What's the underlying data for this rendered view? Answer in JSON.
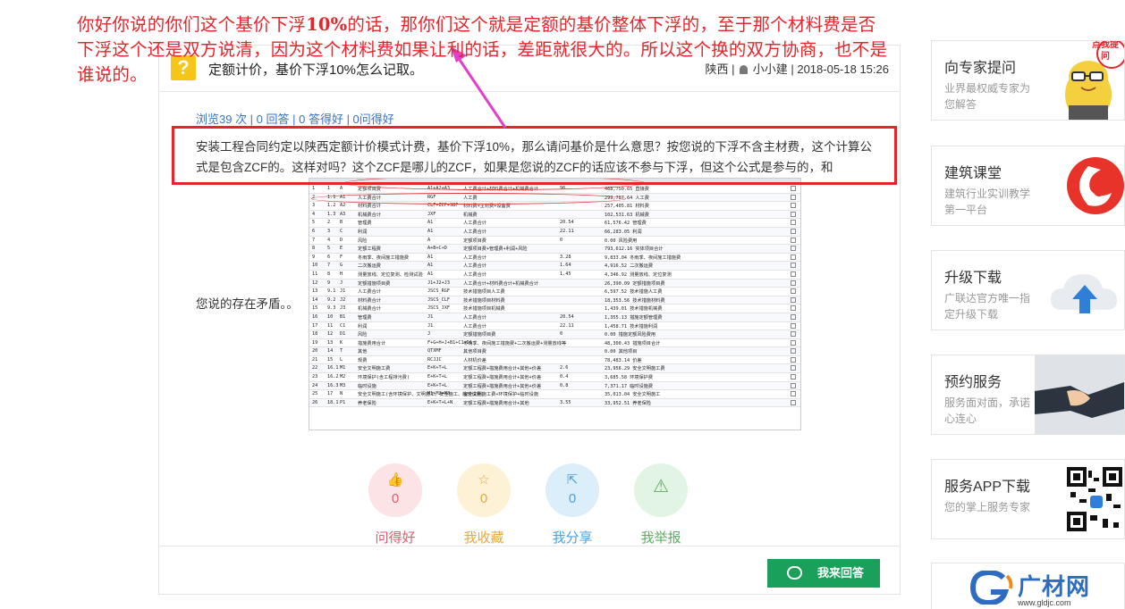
{
  "annotation": {
    "line1": "你好你说的你们这个基价下浮",
    "line1_bold": "10%",
    "line1_rest": "的话，那你们这个就是定额的基价整体下浮的，至于那个材料费是否",
    "line2": "下浮这个还是双方说清，因为这个材料费如果让利的话，差距就很大的。所以这个换的双方协商，也不是",
    "line3": "谁说的。"
  },
  "question": {
    "icon": "?",
    "title": "定额计价，基价下浮10%怎么记取。",
    "region": "陕西",
    "author": "小小建",
    "date": "2018-05-18 15:26",
    "stats": "浏览39 次 | 0 回答 | 0 答得好 | 0问得好",
    "body": "安装工程合同约定以陕西定额计价模式计费，基价下浮10%，那么请问基价是什么意思？按您说的下浮不含主材费，这个计算公式是包含ZCF的。这样对吗？这个ZCF是哪儿的ZCF，如果是您说的ZCF的话应该不参与下浮，但这个公式是参与的，和",
    "note": "您说的存在矛盾。。"
  },
  "sheet": {
    "rows": [
      [
        "1",
        "1",
        "A",
        "定额项目费",
        "A1+A2+A3",
        "人工费合计+材料费合计+机械费合计",
        "96",
        "468,750.65 直接费"
      ],
      [
        "2",
        "1.1",
        "A1",
        "人工费合计",
        "RGF",
        "人工费",
        "",
        "299,787.64 人工费"
      ],
      [
        "3",
        "1.2",
        "A2",
        "材料费合计",
        "CLF+ZCF+SBF",
        "材料费+主材费+设备费",
        "",
        "257,405.81 材料费"
      ],
      [
        "4",
        "1.3",
        "A3",
        "机械费合计",
        "JXF",
        "机械费",
        "",
        "102,531.63 机械费"
      ],
      [
        "5",
        "2",
        "B",
        "管理费",
        "A1",
        "人工费合计",
        "20.54",
        "61,576.42 管理费"
      ],
      [
        "6",
        "3",
        "C",
        "利润",
        "A1",
        "人工费合计",
        "22.11",
        "66,283.05 利润"
      ],
      [
        "7",
        "4",
        "D",
        "风险",
        "A",
        "定额项目费",
        "0",
        "0.00 风险费用"
      ],
      [
        "8",
        "5",
        "E",
        "定额工程费",
        "A+B+C+D",
        "定额项目费+管理费+利润+风险",
        "",
        "793,612.16 实体项目合计"
      ],
      [
        "9",
        "6",
        "F",
        "冬雨季、夜间施工措施费",
        "A1",
        "人工费合计",
        "3.28",
        "9,833.04 冬雨季、夜间施工措施费"
      ],
      [
        "10",
        "7",
        "G",
        "二次搬运费",
        "A1",
        "人工费合计",
        "1.64",
        "4,916.52 二次搬运费"
      ],
      [
        "11",
        "8",
        "H",
        "测量放线、定位复测、检测试验",
        "A1",
        "人工费合计",
        "1.45",
        "4,346.92 测量放线、定位复测"
      ],
      [
        "12",
        "9",
        "J",
        "定额措施项目费",
        "J1+J2+J3",
        "人工费合计+材料费合计+机械费合计",
        "",
        "26,390.09 定额措施项目费"
      ],
      [
        "13",
        "9.1",
        "J1",
        "人工费合计",
        "JSCS_RGF",
        "技术措施项目人工费",
        "",
        "6,597.52 技术措施人工费"
      ],
      [
        "14",
        "9.2",
        "J2",
        "材料费合计",
        "JSCS_CLF",
        "技术措施项目材料费",
        "",
        "18,353.56 技术措施材料费"
      ],
      [
        "15",
        "9.3",
        "J3",
        "机械费合计",
        "JSCS_JXF",
        "技术措施项目机械费",
        "",
        "1,439.01 技术措施机械费"
      ],
      [
        "16",
        "10",
        "B1",
        "管理费",
        "J1",
        "人工费合计",
        "20.54",
        "1,355.13 措施定额管理费"
      ],
      [
        "17",
        "11",
        "C1",
        "利润",
        "J1",
        "人工费合计",
        "22.11",
        "1,458.71 技术措施利润"
      ],
      [
        "18",
        "12",
        "D1",
        "风险",
        "J",
        "定额措施项目费",
        "0",
        "0.00 措施定额风险费用"
      ],
      [
        "19",
        "13",
        "K",
        "措施费用合计",
        "F+G+H+J+B1+C1+D1",
        "冬雨季、夜间施工措施费+二次搬运费+测量放线等",
        "",
        "48,300.43 措施项目合计"
      ],
      [
        "20",
        "14",
        "T",
        "其他",
        "QTXMF",
        "其他项目费",
        "",
        "0.00 其他项目"
      ],
      [
        "21",
        "15",
        "L",
        "规费",
        "RCJJC",
        "人材机价差",
        "",
        "78,483.14 价差"
      ],
      [
        "22",
        "16.1",
        "M1",
        "安全文明施工费",
        "E+K+T+L",
        "定额工程费+措施费用合计+其他+价差",
        "2.6",
        "23,956.29 安全文明施工费"
      ],
      [
        "23",
        "16.2",
        "M2",
        "环境保护(含工程排污费)",
        "E+K+T+L",
        "定额工程费+措施费用合计+其他+价差",
        "0.4",
        "3,685.58 环境保护费"
      ],
      [
        "24",
        "16.3",
        "M3",
        "临时设施",
        "E+K+T+L",
        "定额工程费+措施费用合计+其他+价差",
        "0.8",
        "7,371.17 临时设施费"
      ],
      [
        "25",
        "17",
        "N",
        "安全文明施工(含环境保护、文明施工、安全施工、临时设施)",
        "M1+M2+M3",
        "安全文明施工费+环境保护+临时设施",
        "",
        "35,013.04 安全文明施工"
      ],
      [
        "26",
        "18.1",
        "P1",
        "养老保险",
        "E+K+T+L+N",
        "定额工程费+措施费用合计+其他",
        "3.55",
        "33,952.51 养老保险"
      ]
    ]
  },
  "actions": [
    {
      "icon": "👍",
      "count": "0",
      "label": "问得好"
    },
    {
      "icon": "☆",
      "count": "0",
      "label": "我收藏"
    },
    {
      "icon": "⇱",
      "count": "0",
      "label": "我分享"
    },
    {
      "icon": "⚠",
      "count": "",
      "label": "我举报"
    }
  ],
  "answer_button": "我来回答",
  "sidebar": [
    {
      "title": "向专家提问",
      "sub": "业界最权威专家为您解答",
      "badge": "点我提问"
    },
    {
      "title": "建筑课堂",
      "sub": "建筑行业实训教学第一平台"
    },
    {
      "title": "升级下载",
      "sub": "广联达官方唯一指定升级下载"
    },
    {
      "title": "预约服务",
      "sub": "服务面对面，承诺心连心"
    },
    {
      "title": "服务APP下载",
      "sub": "您的掌上服务专家"
    }
  ],
  "logo": {
    "text": "广材网",
    "url": "www.gldjc.com"
  },
  "colors": {
    "annotation": "#e8242b",
    "stats_link": "#3a74c0",
    "answer_btn": "#1aa05a",
    "logo": "#2d6cc0"
  }
}
